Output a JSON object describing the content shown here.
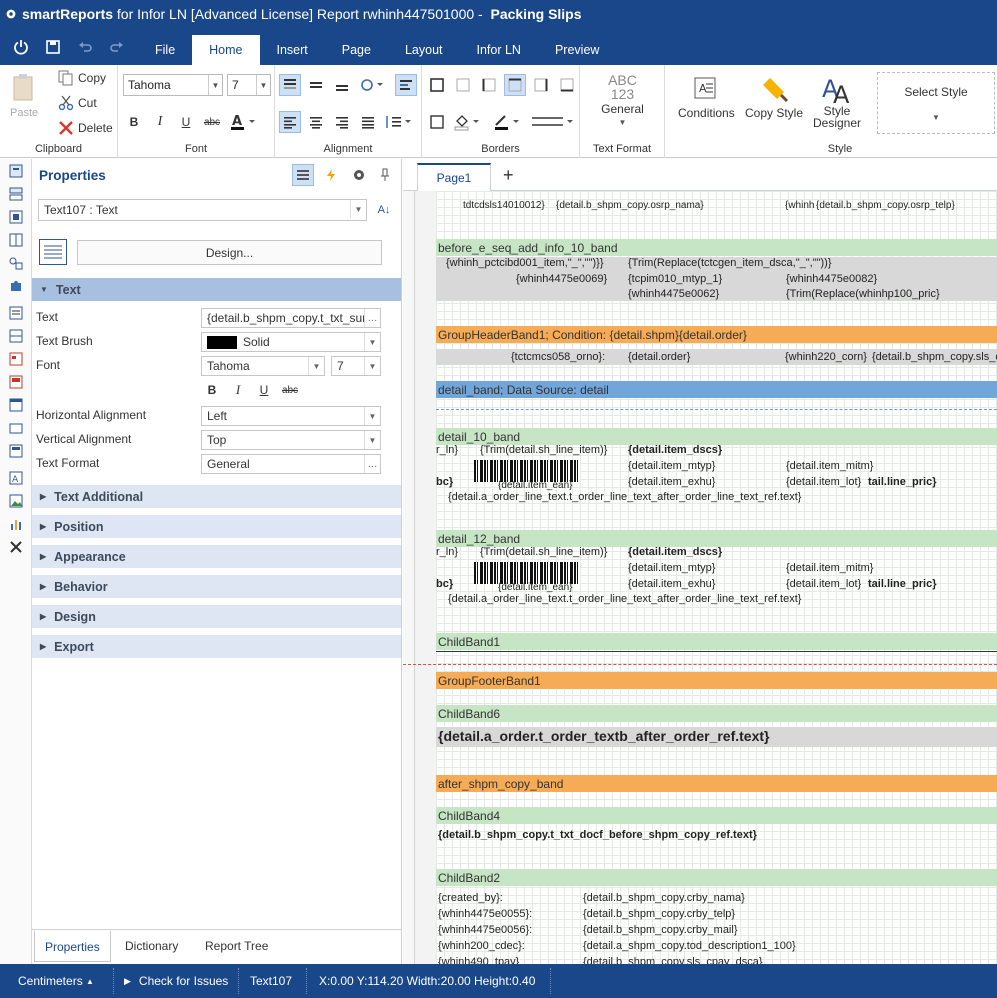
{
  "window": {
    "app": "smartReports",
    "title_rest": "for Infor LN [Advanced License]  Report rwhinh447501000  -",
    "doc": "Packing Slips"
  },
  "menu": {
    "tabs": [
      "File",
      "Home",
      "Insert",
      "Page",
      "Layout",
      "Infor LN",
      "Preview"
    ],
    "active": "Home"
  },
  "ribbon": {
    "clipboard": {
      "paste": "Paste",
      "copy": "Copy",
      "cut": "Cut",
      "delete": "Delete",
      "label": "Clipboard"
    },
    "font": {
      "family": "Tahoma",
      "size": "7",
      "label": "Font"
    },
    "alignment": {
      "label": "Alignment"
    },
    "borders": {
      "label": "Borders"
    },
    "text_format": {
      "abc": "ABC",
      "num": "123",
      "value": "General",
      "label": "Text Format"
    },
    "style": {
      "conditions": "Conditions",
      "copy_style": "Copy Style",
      "designer1": "Style",
      "designer2": "Designer",
      "select": "Select Style",
      "label": "Style"
    }
  },
  "properties": {
    "title": "Properties",
    "component": "Text107 : Text",
    "design_button": "Design...",
    "text_section": "Text",
    "rows": {
      "text_label": "Text",
      "text_value": "{detail.b_shpm_copy.t_txt_sur",
      "brush_label": "Text Brush",
      "brush_value": "Solid",
      "font_label": "Font",
      "font_family": "Tahoma",
      "font_size": "7",
      "halign_label": "Horizontal Alignment",
      "halign_value": "Left",
      "valign_label": "Vertical Alignment",
      "valign_value": "Top",
      "format_label": "Text Format",
      "format_value": "General"
    },
    "sections": [
      "Text Additional",
      "Position",
      "Appearance",
      "Behavior",
      "Design",
      "Export"
    ],
    "bottom_tabs": [
      "Properties",
      "Dictionary",
      "Report Tree"
    ]
  },
  "status": {
    "units": "Centimeters",
    "check": "Check for Issues",
    "component": "Text107",
    "geometry": "X:0.00 Y:114.20 Width:20.00 Height:0.40"
  },
  "designer": {
    "page_tab": "Page1",
    "bands": {
      "before": "before_e_seq_add_info_10_band",
      "group_header": "GroupHeaderBand1; Condition: {detail.shpm}{detail.order}",
      "detail": "detail_band; Data Source: detail",
      "detail10": "detail_10_band",
      "detail12": "detail_12_band",
      "child1": "ChildBand1",
      "group_footer": "GroupFooterBand1",
      "child6": "ChildBand6",
      "after": "after_shpm_copy_band",
      "child4": "ChildBand4",
      "child2": "ChildBand2"
    },
    "fields": {
      "top1": "tdtcdsls14010012}",
      "top2": "{detail.b_shpm_copy.osrp_nama}",
      "top3": "{whinh",
      "top4": "{detail.b_shpm_copy.osrp_telp}",
      "b1": "{whinh_pctcibd001_item,\"_\",\"\")}}",
      "b2": "{whinh4475e0069}",
      "b3": "{Trim(Replace(tctcgen_item_dsca,\"_\",\"\"))}",
      "b4": "{tcpim010_mtyp_1}",
      "b5": "{whinh4475e0062}",
      "b6": "{whinh4475e0082}",
      "b7": "{Trim(Replace(whinhp100_pric}",
      "g1": "{tctcmcs058_orno}:",
      "g2": "{detail.order}",
      "g3": "{whinh220_corn}",
      "g4": "{detail.b_shpm_copy.sls_co",
      "d1": "r_ln}",
      "d2": "{Trim(detail.sh_line_item)}",
      "d3": "{detail.item_dscs}",
      "d4": "{detail.item_mtyp}",
      "d5": "{detail.item_mitm}",
      "d6": "{detail.item_exhu}",
      "d7": "{detail.item_lot}",
      "d8": "tail.line_pric}",
      "d9": "{detail.item_ean}",
      "d10": "bc}",
      "d11": "{detail.a_order_line_text.t_order_line_text_after_order_line_text_ref.text}",
      "order_text": "{detail.a_order.t_order_textb_after_order_ref.text}",
      "docf": "{detail.b_shpm_copy.t_txt_docf_before_shpm_copy_ref.text}",
      "c1": "{created_by}:",
      "c2": "{whinh4475e0055}:",
      "c3": "{whinh4475e0056}:",
      "c4": "{whinh200_cdec}:",
      "c5": "{whinh490_tpay}",
      "c6": "{detail.b_shpm_copy.crby_nama}",
      "c7": "{detail.b_shpm_copy.crby_telp}",
      "c8": "{detail.b_shpm_copy.crby_mail}",
      "c9": "{detail.a_shpm_copy.tod_description1_100}",
      "c10": "{detail.b_shpm_copy.sls_cpay_dsca}"
    }
  }
}
